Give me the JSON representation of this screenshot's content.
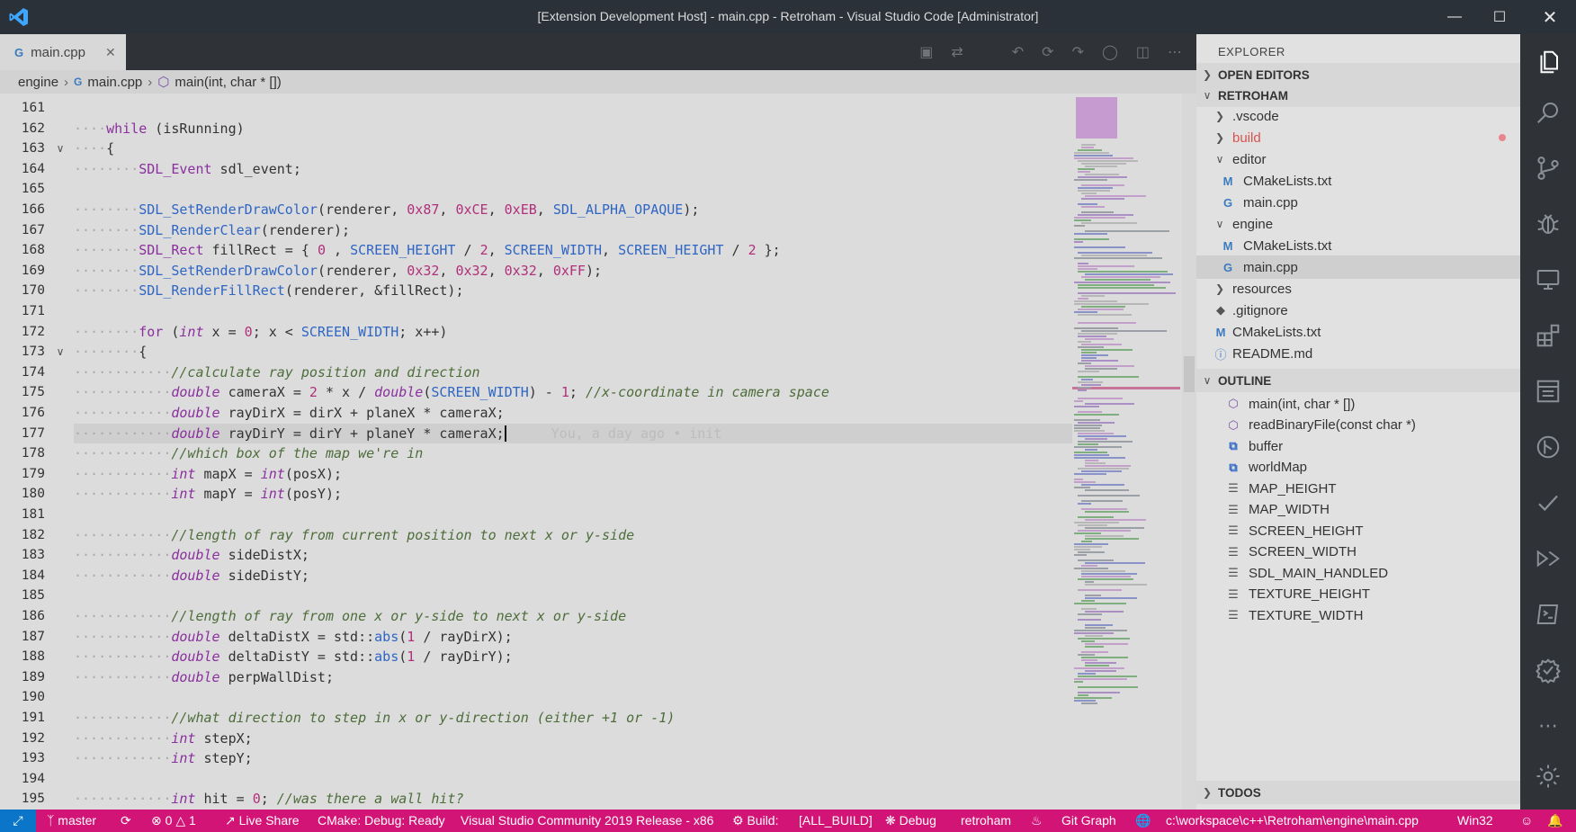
{
  "window": {
    "title": "[Extension Development Host] - main.cpp - Retroham - Visual Studio Code [Administrator]"
  },
  "tabs": [
    {
      "label": "main.cpp",
      "icon": "cpp-file-icon"
    }
  ],
  "breadcrumb": {
    "folder": "engine",
    "file": "main.cpp",
    "symbol": "main(int, char * [])"
  },
  "editor": {
    "lines": [
      {
        "no": "161",
        "text": ""
      },
      {
        "no": "162",
        "text": "while (isRunning)"
      },
      {
        "no": "163",
        "text": "{"
      },
      {
        "no": "164",
        "text": "SDL_Event sdl_event;"
      },
      {
        "no": "165",
        "text": ""
      },
      {
        "no": "166",
        "text": "SDL_SetRenderDrawColor(renderer, 0x87, 0xCE, 0xEB, SDL_ALPHA_OPAQUE);"
      },
      {
        "no": "167",
        "text": "SDL_RenderClear(renderer);"
      },
      {
        "no": "168",
        "text": "SDL_Rect fillRect = { 0 , SCREEN_HEIGHT / 2, SCREEN_WIDTH, SCREEN_HEIGHT / 2 };"
      },
      {
        "no": "169",
        "text": "SDL_SetRenderDrawColor(renderer, 0x32, 0x32, 0x32, 0xFF);"
      },
      {
        "no": "170",
        "text": "SDL_RenderFillRect(renderer, &fillRect);"
      },
      {
        "no": "171",
        "text": ""
      },
      {
        "no": "172",
        "text": "for (int x = 0; x < SCREEN_WIDTH; x++)"
      },
      {
        "no": "173",
        "text": "{"
      },
      {
        "no": "174",
        "text": "//calculate ray position and direction"
      },
      {
        "no": "175",
        "text": "double cameraX = 2 * x / double(SCREEN_WIDTH) - 1; //x-coordinate in camera space"
      },
      {
        "no": "176",
        "text": "double rayDirX = dirX + planeX * cameraX;"
      },
      {
        "no": "177",
        "text": "double rayDirY = dirY + planeY * cameraX;"
      },
      {
        "no": "178",
        "text": "//which box of the map we're in"
      },
      {
        "no": "179",
        "text": "int mapX = int(posX);"
      },
      {
        "no": "180",
        "text": "int mapY = int(posY);"
      },
      {
        "no": "181",
        "text": ""
      },
      {
        "no": "182",
        "text": "//length of ray from current position to next x or y-side"
      },
      {
        "no": "183",
        "text": "double sideDistX;"
      },
      {
        "no": "184",
        "text": "double sideDistY;"
      },
      {
        "no": "185",
        "text": ""
      },
      {
        "no": "186",
        "text": "//length of ray from one x or y-side to next x or y-side"
      },
      {
        "no": "187",
        "text": "double deltaDistX = std::abs(1 / rayDirX);"
      },
      {
        "no": "188",
        "text": "double deltaDistY = std::abs(1 / rayDirY);"
      },
      {
        "no": "189",
        "text": "double perpWallDist;"
      },
      {
        "no": "190",
        "text": ""
      },
      {
        "no": "191",
        "text": "//what direction to step in x or y-direction (either +1 or -1)"
      },
      {
        "no": "192",
        "text": "int stepX;"
      },
      {
        "no": "193",
        "text": "int stepY;"
      },
      {
        "no": "194",
        "text": ""
      },
      {
        "no": "195",
        "text": "int hit = 0; //was there a wall hit?"
      }
    ],
    "blame": "You, a day ago • init"
  },
  "explorer": {
    "title": "EXPLORER",
    "open_editors": "OPEN EDITORS",
    "project": "RETROHAM",
    "tree": [
      ".vscode",
      "build",
      "editor",
      "CMakeLists.txt",
      "main.cpp",
      "engine",
      "CMakeLists.txt",
      "main.cpp",
      "resources",
      ".gitignore",
      "CMakeLists.txt",
      "README.md"
    ],
    "outline_title": "OUTLINE",
    "outline": [
      "main(int, char * [])",
      "readBinaryFile(const char *)",
      "buffer",
      "worldMap",
      "MAP_HEIGHT",
      "MAP_WIDTH",
      "SCREEN_HEIGHT",
      "SCREEN_WIDTH",
      "SDL_MAIN_HANDLED",
      "TEXTURE_HEIGHT",
      "TEXTURE_WIDTH"
    ],
    "todos_title": "TODOS"
  },
  "statusbar": {
    "branch": "master",
    "errors": "0",
    "warnings": "1",
    "live_share": "Live Share",
    "cmake": "CMake: Debug: Ready",
    "kit": "Visual Studio Community 2019 Release - x86",
    "build": "Build:",
    "build_target": "[ALL_BUILD]",
    "debug": "Debug",
    "project": "retroham",
    "git_graph": "Git Graph",
    "path": "c:\\workspace\\c++\\Retroham\\engine\\main.cpp",
    "platform": "Win32"
  },
  "colors": {
    "statusbar": "#d31477",
    "remote": "#0b76c9",
    "titlebar": "#2b3138",
    "activitybar": "#2f3338"
  }
}
